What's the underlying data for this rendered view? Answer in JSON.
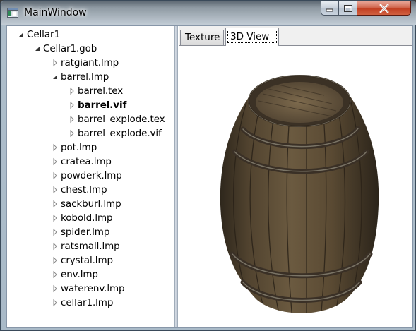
{
  "window": {
    "title": "MainWindow"
  },
  "tree": [
    {
      "label": "Cellar1",
      "expanded": true
    },
    {
      "label": "Cellar1.gob",
      "expanded": true
    },
    {
      "label": "ratgiant.lmp",
      "expanded": false
    },
    {
      "label": "barrel.lmp",
      "expanded": true
    },
    {
      "label": "barrel.tex",
      "expanded": false
    },
    {
      "label": "barrel.vif",
      "expanded": false,
      "selected": true
    },
    {
      "label": "barrel_explode.tex",
      "expanded": false
    },
    {
      "label": "barrel_explode.vif",
      "expanded": false
    },
    {
      "label": "pot.lmp",
      "expanded": false
    },
    {
      "label": "cratea.lmp",
      "expanded": false
    },
    {
      "label": "powderk.lmp",
      "expanded": false
    },
    {
      "label": "chest.lmp",
      "expanded": false
    },
    {
      "label": "sackburl.lmp",
      "expanded": false
    },
    {
      "label": "kobold.lmp",
      "expanded": false
    },
    {
      "label": "spider.lmp",
      "expanded": false
    },
    {
      "label": "ratsmall.lmp",
      "expanded": false
    },
    {
      "label": "crystal.lmp",
      "expanded": false
    },
    {
      "label": "env.lmp",
      "expanded": false
    },
    {
      "label": "waterenv.lmp",
      "expanded": false
    },
    {
      "label": "cellar1.lmp",
      "expanded": false
    }
  ],
  "tabs": [
    {
      "label": "Texture",
      "active": false
    },
    {
      "label": "3D View",
      "active": true
    }
  ],
  "icons": {
    "app": "window-icon",
    "minimize": "minimize-icon",
    "maximize": "maximize-icon",
    "close": "close-icon",
    "expanded": "triangle-down-icon",
    "collapsed": "triangle-right-icon"
  },
  "colors": {
    "close_button": "#c13d20",
    "barrel_wood": "#5a4a32",
    "barrel_hoop": "#3a3026"
  }
}
